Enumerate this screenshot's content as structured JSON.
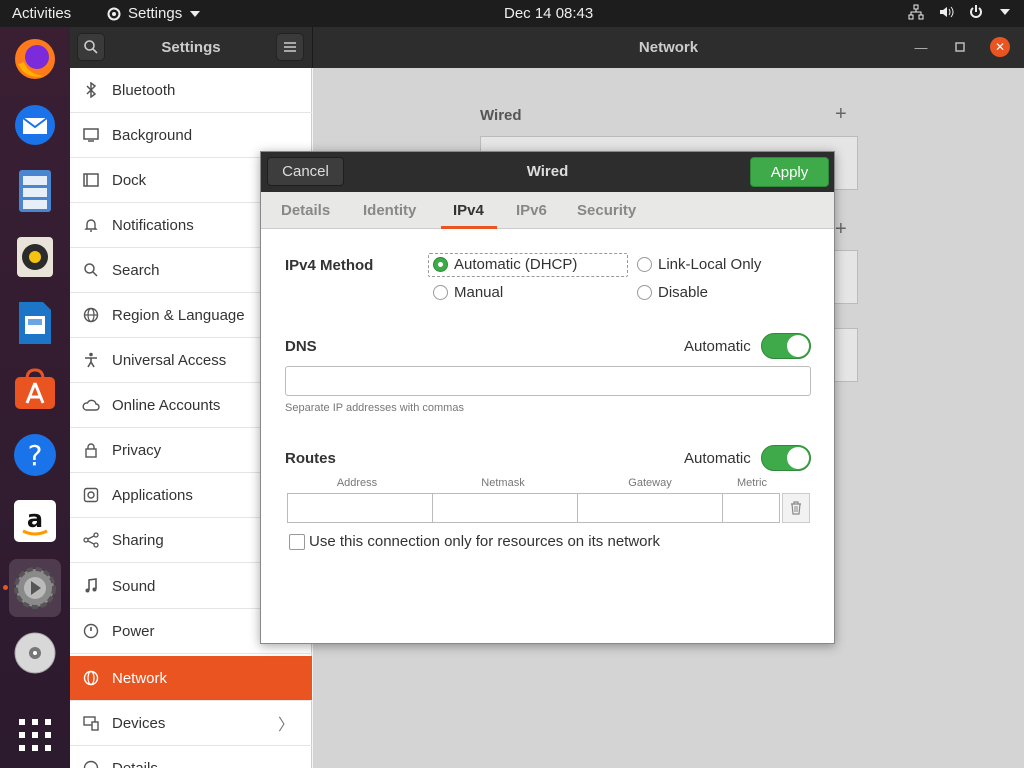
{
  "topbar": {
    "activities": "Activities",
    "app_menu": "Settings",
    "clock": "Dec 14  08:43"
  },
  "dock": {
    "items": [
      "firefox-icon",
      "thunderbird-icon",
      "files-icon",
      "rhythmbox-icon",
      "libreoffice-writer-icon",
      "software-icon",
      "help-icon",
      "amazon-icon",
      "settings-icon",
      "dvd-icon",
      "app-grid-icon"
    ],
    "active": "settings-icon"
  },
  "window": {
    "sidebar_title": "Settings",
    "main_title": "Network"
  },
  "sidebar": {
    "items": [
      {
        "label": "Bluetooth",
        "icon": "bluetooth-icon"
      },
      {
        "label": "Background",
        "icon": "background-icon"
      },
      {
        "label": "Dock",
        "icon": "dock-icon"
      },
      {
        "label": "Notifications",
        "icon": "bell-icon"
      },
      {
        "label": "Search",
        "icon": "search-icon"
      },
      {
        "label": "Region & Language",
        "icon": "globe-icon"
      },
      {
        "label": "Universal Access",
        "icon": "accessibility-icon"
      },
      {
        "label": "Online Accounts",
        "icon": "cloud-icon"
      },
      {
        "label": "Privacy",
        "icon": "lock-icon"
      },
      {
        "label": "Applications",
        "icon": "applications-icon"
      },
      {
        "label": "Sharing",
        "icon": "share-icon"
      },
      {
        "label": "Sound",
        "icon": "music-note-icon"
      },
      {
        "label": "Power",
        "icon": "power-icon"
      },
      {
        "label": "Network",
        "icon": "network-icon"
      },
      {
        "label": "Devices",
        "icon": "devices-icon"
      },
      {
        "label": "Details",
        "icon": "info-icon"
      }
    ],
    "selected": "Network"
  },
  "background": {
    "wired_label": "Wired"
  },
  "dialog": {
    "cancel": "Cancel",
    "title": "Wired",
    "apply": "Apply",
    "tabs": [
      "Details",
      "Identity",
      "IPv4",
      "IPv6",
      "Security"
    ],
    "active_tab": "IPv4",
    "ipv4_method_label": "IPv4 Method",
    "methods": {
      "dhcp": "Automatic (DHCP)",
      "link_local": "Link-Local Only",
      "manual": "Manual",
      "disable": "Disable"
    },
    "selected_method": "Automatic (DHCP)",
    "dns_label": "DNS",
    "dns_automatic_label": "Automatic",
    "dns_automatic": true,
    "dns_value": "",
    "dns_hint": "Separate IP addresses with commas",
    "routes_label": "Routes",
    "routes_automatic_label": "Automatic",
    "routes_automatic": true,
    "route_columns": [
      "Address",
      "Netmask",
      "Gateway",
      "Metric"
    ],
    "route_row": {
      "address": "",
      "netmask": "",
      "gateway": "",
      "metric": ""
    },
    "only_resources_label": "Use this connection only for resources on its network",
    "only_resources_checked": false
  },
  "colors": {
    "accent": "#e95420",
    "switch_on": "#3eaa4a",
    "header": "#2d2d2d"
  }
}
